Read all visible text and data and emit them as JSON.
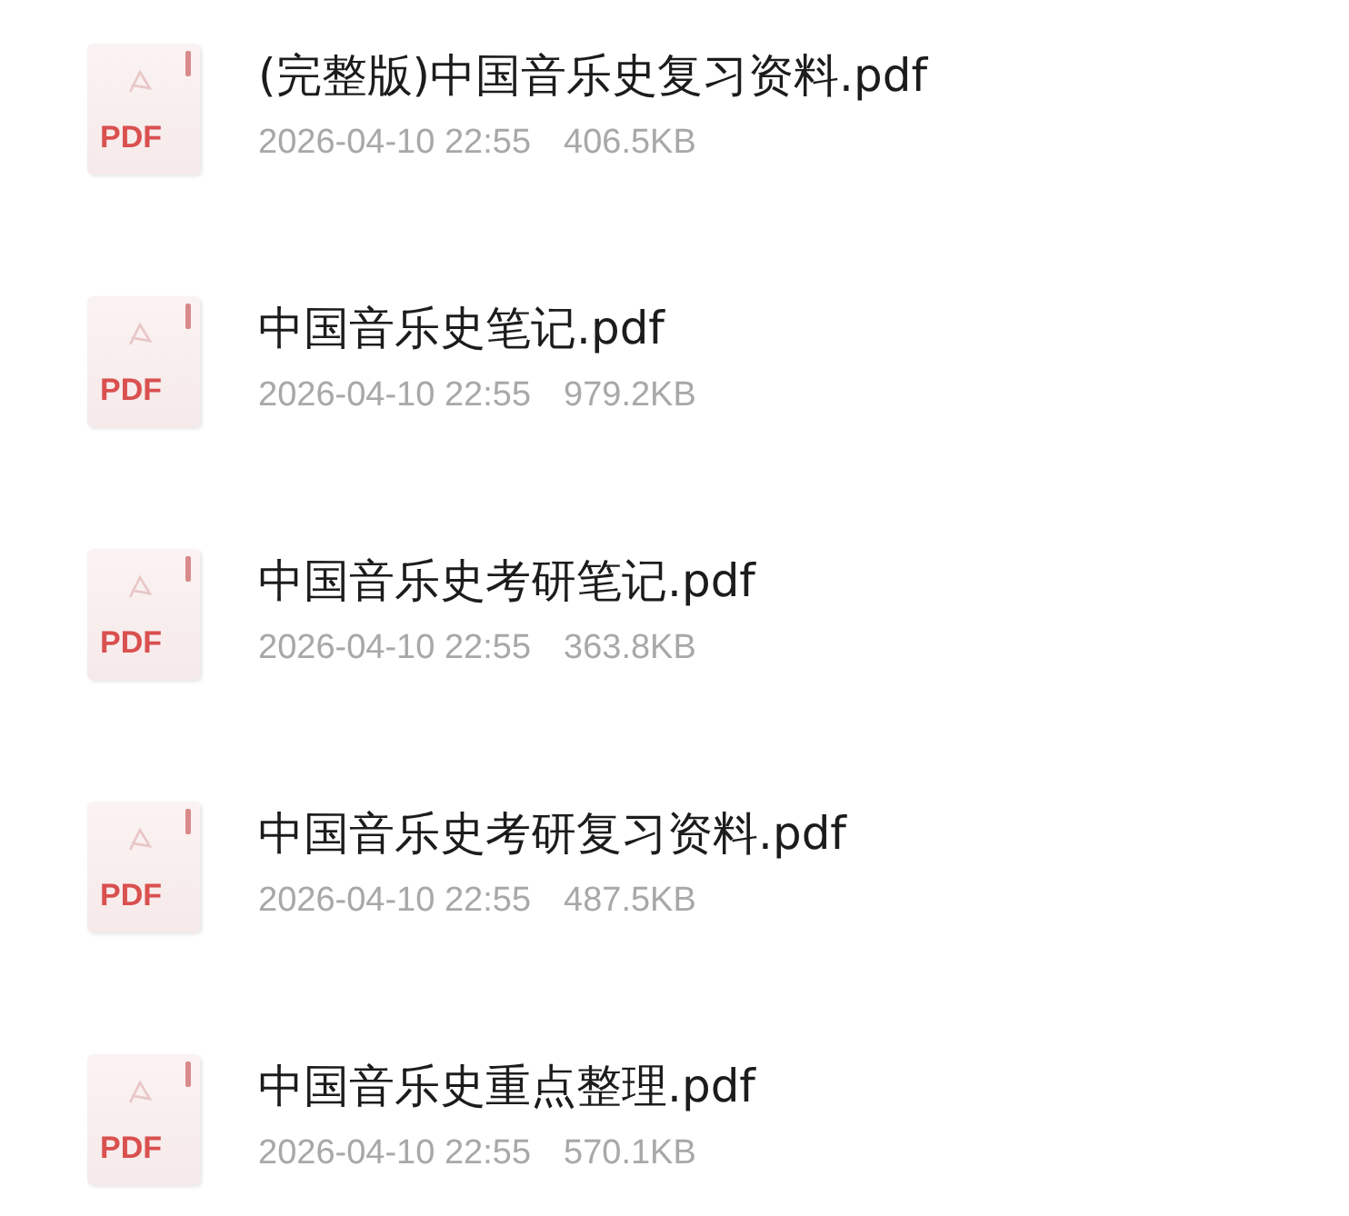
{
  "files": [
    {
      "icon_label": "PDF",
      "name": "(完整版)中国音乐史复习资料.pdf",
      "date": "2026-04-10 22:55",
      "size": "406.5KB"
    },
    {
      "icon_label": "PDF",
      "name": "中国音乐史笔记.pdf",
      "date": "2026-04-10 22:55",
      "size": "979.2KB"
    },
    {
      "icon_label": "PDF",
      "name": "中国音乐史考研笔记.pdf",
      "date": "2026-04-10 22:55",
      "size": "363.8KB"
    },
    {
      "icon_label": "PDF",
      "name": "中国音乐史考研复习资料.pdf",
      "date": "2026-04-10 22:55",
      "size": "487.5KB"
    },
    {
      "icon_label": "PDF",
      "name": "中国音乐史重点整理.pdf",
      "date": "2026-04-10 22:55",
      "size": "570.1KB"
    }
  ]
}
